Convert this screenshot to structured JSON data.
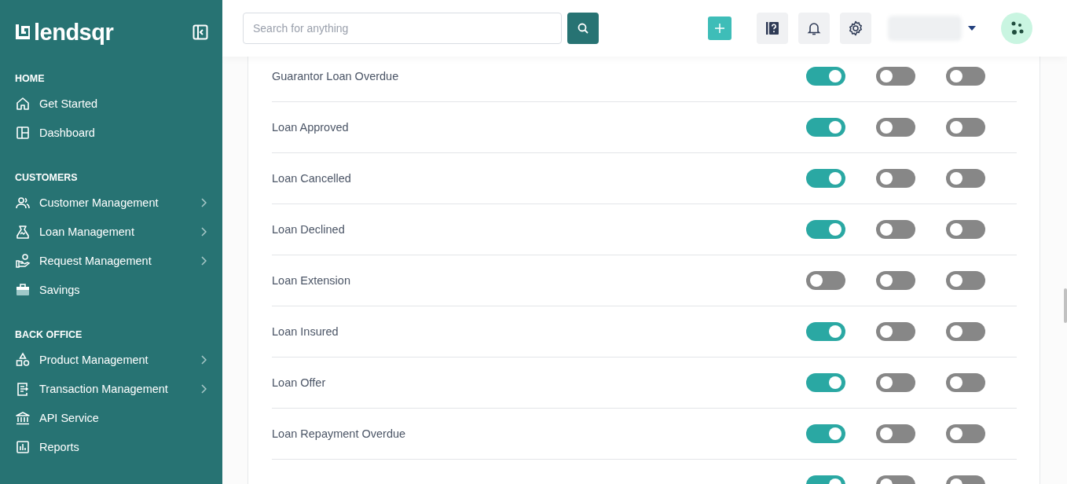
{
  "sidebar": {
    "logo": "lendsqr",
    "sections": [
      {
        "title": "HOME",
        "items": [
          {
            "label": "Get Started",
            "has_submenu": false
          },
          {
            "label": "Dashboard",
            "has_submenu": false
          }
        ]
      },
      {
        "title": "CUSTOMERS",
        "items": [
          {
            "label": "Customer Management",
            "has_submenu": true
          },
          {
            "label": "Loan Management",
            "has_submenu": true
          },
          {
            "label": "Request Management",
            "has_submenu": true
          },
          {
            "label": "Savings",
            "has_submenu": false
          }
        ]
      },
      {
        "title": "BACK OFFICE",
        "items": [
          {
            "label": "Product Management",
            "has_submenu": true
          },
          {
            "label": "Transaction Management",
            "has_submenu": true
          },
          {
            "label": "API Service",
            "has_submenu": false
          },
          {
            "label": "Reports",
            "has_submenu": false
          }
        ]
      }
    ]
  },
  "topbar": {
    "search": {
      "placeholder": "Search for anything"
    }
  },
  "notifications": [
    {
      "name": "Guarantor Loan Overdue",
      "channels": [
        {
          "on": true
        },
        {
          "on": false
        },
        {
          "on": false
        }
      ]
    },
    {
      "name": "Loan Approved",
      "channels": [
        {
          "on": true
        },
        {
          "on": false
        },
        {
          "on": false
        }
      ]
    },
    {
      "name": "Loan Cancelled",
      "channels": [
        {
          "on": true
        },
        {
          "on": false
        },
        {
          "on": false
        }
      ]
    },
    {
      "name": "Loan Declined",
      "channels": [
        {
          "on": true
        },
        {
          "on": false
        },
        {
          "on": false
        }
      ]
    },
    {
      "name": "Loan Extension",
      "channels": [
        {
          "on": false
        },
        {
          "on": false
        },
        {
          "on": false
        }
      ]
    },
    {
      "name": "Loan Insured",
      "channels": [
        {
          "on": true
        },
        {
          "on": false
        },
        {
          "on": false
        }
      ]
    },
    {
      "name": "Loan Offer",
      "channels": [
        {
          "on": true
        },
        {
          "on": false
        },
        {
          "on": false
        }
      ]
    },
    {
      "name": "Loan Repayment Overdue",
      "channels": [
        {
          "on": true
        },
        {
          "on": false
        },
        {
          "on": false
        }
      ]
    },
    {
      "channels": [
        {
          "on": true
        },
        {
          "on": false
        },
        {
          "on": false
        }
      ]
    }
  ]
}
